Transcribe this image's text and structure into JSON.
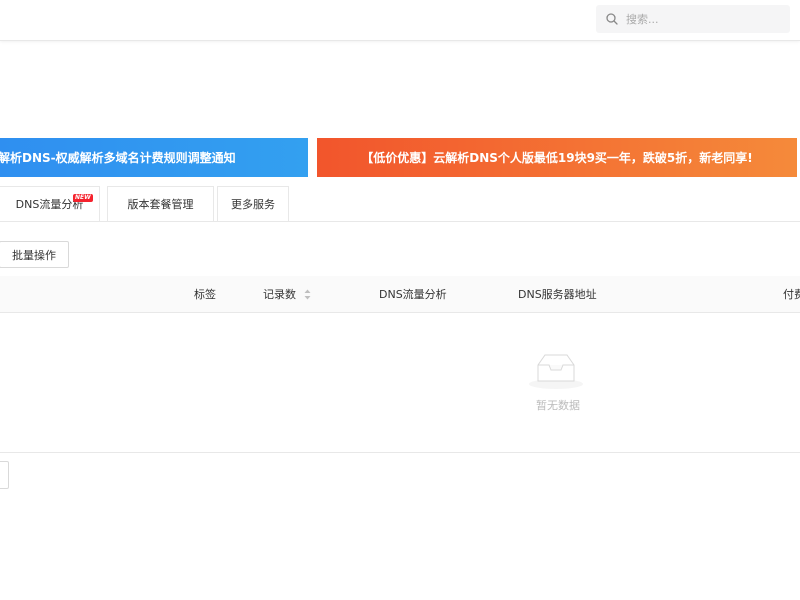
{
  "header": {
    "search": {
      "placeholder": "搜索..."
    }
  },
  "banners": [
    {
      "text": "解析DNS-权威解析多域名计费规则调整通知",
      "color": "#2f8ff0"
    },
    {
      "text": "【低价优惠】云解析DNS个人版最低19块9买一年，跌破5折，新老同享!",
      "color": "#f2552c"
    }
  ],
  "tabs": [
    {
      "label": "DNS流量分析",
      "badge": "NEW"
    },
    {
      "label": "版本套餐管理"
    },
    {
      "label": "更多服务"
    }
  ],
  "toolbar": {
    "batch_label": "批量操作"
  },
  "table": {
    "columns": [
      "标签",
      "记录数",
      "DNS流量分析",
      "DNS服务器地址",
      "付费"
    ],
    "rows": [],
    "empty_text": "暂无数据"
  },
  "colors": {
    "border": "#e8e8e8",
    "badge": "#f5222d",
    "muted_text": "#bbbbbb"
  },
  "icons": {
    "search": "search-icon",
    "sort": "sort-icon",
    "empty": "empty-inbox-icon"
  }
}
